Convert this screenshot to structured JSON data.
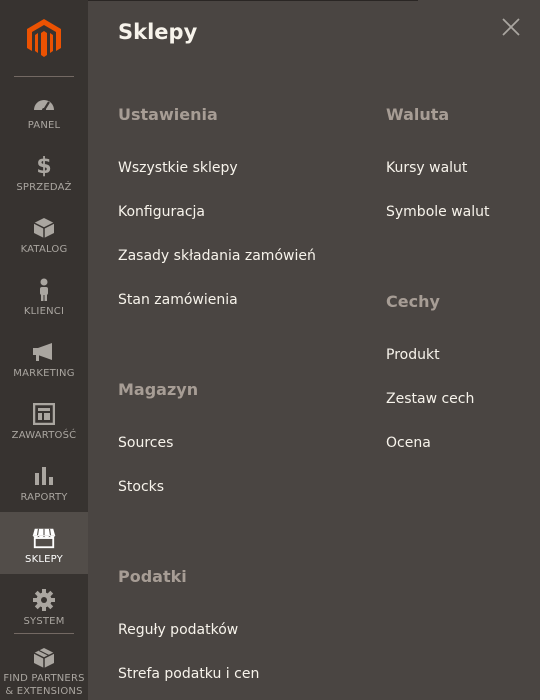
{
  "sidebar": {
    "items": [
      {
        "label": "PANEL",
        "icon": "dashboard-icon"
      },
      {
        "label": "SPRZEDAŻ",
        "icon": "dollar-icon"
      },
      {
        "label": "KATALOG",
        "icon": "box-icon"
      },
      {
        "label": "KLIENCI",
        "icon": "person-icon"
      },
      {
        "label": "MARKETING",
        "icon": "megaphone-icon"
      },
      {
        "label": "ZAWARTOŚĆ",
        "icon": "layout-icon"
      },
      {
        "label": "RAPORTY",
        "icon": "bar-chart-icon"
      },
      {
        "label": "SKLEPY",
        "icon": "store-icon",
        "active": true
      },
      {
        "label": "SYSTEM",
        "icon": "gear-icon"
      }
    ],
    "partners": {
      "line1": "FIND PARTNERS",
      "line2": "& EXTENSIONS"
    }
  },
  "panel": {
    "title": "Sklepy",
    "sections": {
      "ustawienia": {
        "title": "Ustawienia",
        "links": [
          "Wszystkie sklepy",
          "Konfiguracja",
          "Zasady składania zamówień",
          "Stan zamówienia"
        ]
      },
      "magazyn": {
        "title": "Magazyn",
        "links": [
          "Sources",
          "Stocks"
        ]
      },
      "podatki": {
        "title": "Podatki",
        "links": [
          "Reguły podatków",
          "Strefa podatku i cen"
        ]
      },
      "waluta": {
        "title": "Waluta",
        "links": [
          "Kursy walut",
          "Symbole walut"
        ]
      },
      "cechy": {
        "title": "Cechy",
        "links": [
          "Produkt",
          "Zestaw cech",
          "Ocena"
        ]
      }
    }
  },
  "colors": {
    "brand": "#eb5202",
    "sidebar_bg": "#373330",
    "panel_bg": "#4a4542",
    "active_bg": "#524d49",
    "section_title": "#a79d95",
    "link": "#f7f3eb"
  }
}
